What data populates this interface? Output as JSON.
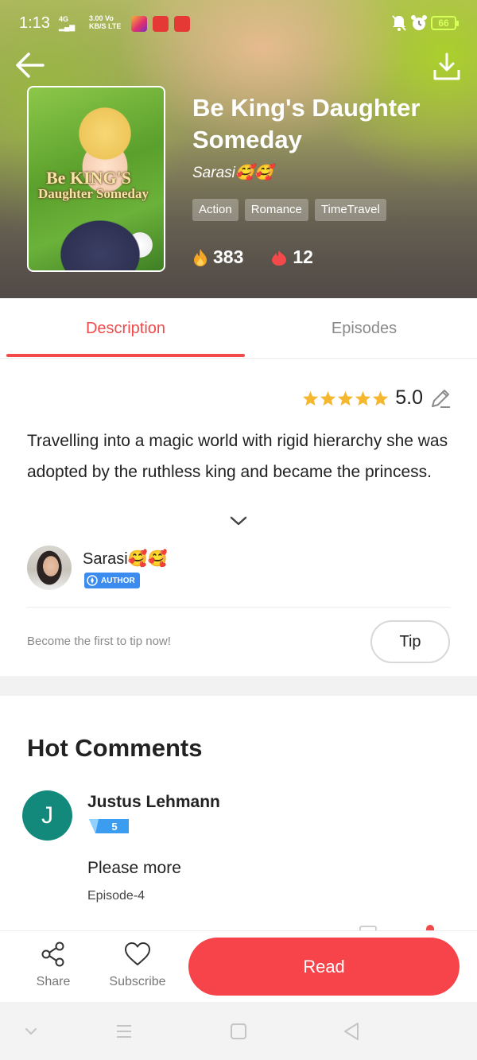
{
  "status_bar": {
    "time": "1:13",
    "network": "4G",
    "speed_value": "3.00",
    "speed_unit": "KB/S",
    "carrier_line1": "Vo",
    "carrier_line2": "LTE",
    "battery": "66"
  },
  "book": {
    "title": "Be King's Daughter Someday",
    "author": "Sarasi🥰🥰",
    "cover_title_line1": "Be KING'S",
    "cover_title_line2": "Daughter Someday",
    "tags": [
      "Action",
      "Romance",
      "TimeTravel"
    ],
    "popularity": "383",
    "likes": "12"
  },
  "tabs": {
    "description": "Description",
    "episodes": "Episodes",
    "active": "Description"
  },
  "description": {
    "rating": "5.0",
    "stars": 5,
    "text": "Travelling into a magic world with rigid hierarchy she was adopted by the ruthless king and became the princess."
  },
  "author_info": {
    "name": "Sarasi🥰🥰",
    "badge": "AUTHOR"
  },
  "tip": {
    "prompt": "Become the first to tip now!",
    "button": "Tip"
  },
  "comments": {
    "heading": "Hot Comments",
    "items": [
      {
        "avatar_letter": "J",
        "user": "Justus Lehmann",
        "level": "5",
        "text": "Please more",
        "episode": "Episode-4"
      }
    ]
  },
  "bottom_bar": {
    "share": "Share",
    "subscribe": "Subscribe",
    "read": "Read"
  },
  "colors": {
    "accent": "#f24a4a",
    "read_button": "#f7444b",
    "comment_avatar": "#12897a",
    "author_badge": "#3c8cf0",
    "star": "#f5b730"
  }
}
